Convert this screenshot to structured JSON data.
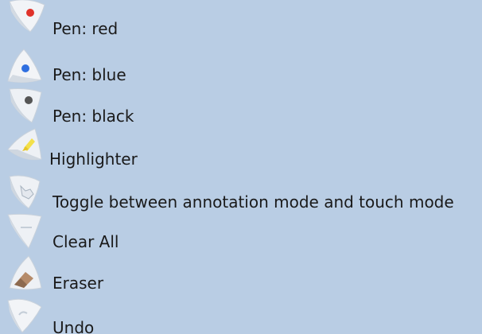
{
  "tools": [
    {
      "label": "Pen: red",
      "icon": "pen-red-icon",
      "dot_color": "#e0322a"
    },
    {
      "label": "Pen: blue",
      "icon": "pen-blue-icon",
      "dot_color": "#2f6fe0"
    },
    {
      "label": "Pen: black",
      "icon": "pen-black-icon",
      "dot_color": "#555555"
    },
    {
      "label": "Highlighter",
      "icon": "highlighter-icon",
      "accent_color": "#f3e04a"
    },
    {
      "label": "Toggle between annotation mode and touch mode",
      "icon": "touch-hand-icon"
    },
    {
      "label": "Clear All",
      "icon": "clear-all-icon"
    },
    {
      "label": "Eraser",
      "icon": "eraser-icon",
      "accent_color": "#b58b6a"
    },
    {
      "label": "Undo",
      "icon": "undo-icon"
    }
  ],
  "colors": {
    "background": "#b9cde4",
    "icon_face": "#eef1f5"
  }
}
